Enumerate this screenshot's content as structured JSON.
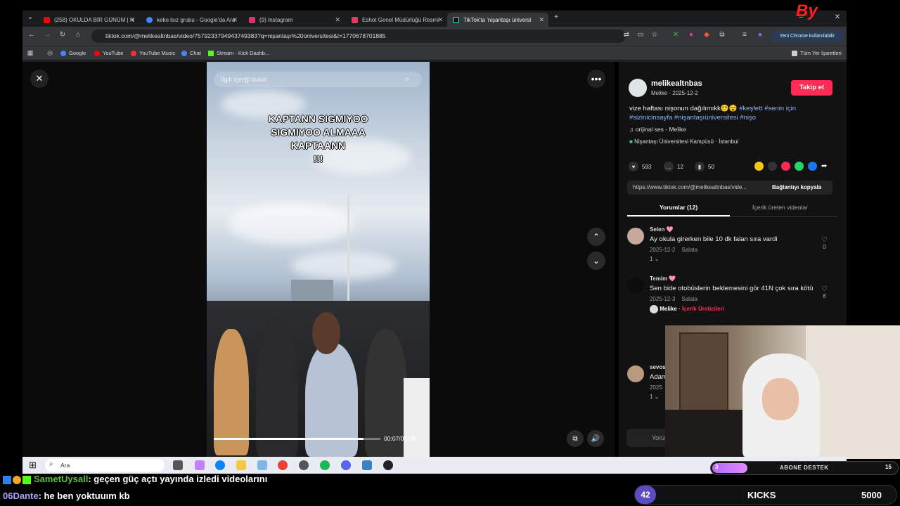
{
  "browser": {
    "tabs": [
      {
        "label": "(258) OKULDA BİR GÜNÜM | N",
        "color": "#ff0000"
      },
      {
        "label": "keko lsız grubu - Google'da Ara",
        "color": "#4285f4"
      },
      {
        "label": "(9) Instagram",
        "color": "#e1306c"
      },
      {
        "label": "Eshot Genel Müdürlüğü Resmi",
        "color": "#e33b5c"
      },
      {
        "label": "TikTok'ta 'nişantaşı üniversi",
        "color": "#111111"
      }
    ],
    "url": "tiktok.com/@melikealtnbas/video/7579233794943749383?q=nişantaşı%20üniversitesi&t=1770678701885",
    "profile_button": "Yeni Chrome kullanılabilir",
    "bookmarks": [
      "Google",
      "YouTube",
      "YouTube Music",
      "Chat",
      "Stream - Kick Dashb..."
    ],
    "all_bookmarks": "Tüm Yer İşaretleri"
  },
  "video": {
    "search_placeholder": "İlgili içeriği bulun",
    "caption_lines": [
      "KAPTANN SIGMIYOO",
      "SIGMIYOO ALMAAA",
      "KAPTAANN",
      "!!!"
    ],
    "time": "00:07/00:08",
    "progress": 0.9
  },
  "post": {
    "username": "melikealtnbas",
    "subline": "Melike · 2025-12-2",
    "follow": "Takip et",
    "description": "vize haftası nişonun dağılımıkk😵‍💫😵 ",
    "hashtags": "#keşfett #senin için #sizinicinsayfa #nişantaşıüniversitesi #nişo",
    "sound": "orijinal ses - Melike",
    "location": "Nişantaşı Üniversitesi Kampüsü · İstanbul",
    "likes": "593",
    "comments": "12",
    "saves": "50",
    "link": "https://www.tiktok.com/@melikealtnbas/vide...",
    "copy_link": "Bağlantıyı kopyala",
    "tab_comments": "Yorumlar (12)",
    "tab_creator": "İçerik üreten videolar",
    "comment_input": "Yorum"
  },
  "comments": [
    {
      "name": "Selen 🩷",
      "text": "Ay okula girerken bile 10 dk falan sıra vardi",
      "date": "2025-12-2",
      "reply": "Salata",
      "likes": "0",
      "replies": "1"
    },
    {
      "name": "Temim 🩷",
      "text": "Sen bide otobüslerin beklemesini gör 41N çok sıra kötü",
      "date": "2025-12-3",
      "reply": "Salata",
      "likes": "8",
      "creator": "Melike",
      "creator_tag": "İçerik Üreticileri"
    },
    {
      "name": "sevos",
      "text": "Adam",
      "date": "2025",
      "replies": "1"
    }
  ],
  "taskbar": {
    "search": "Ara"
  },
  "overlay": {
    "chat": [
      {
        "user": "SametUysall",
        "message": ": geçen güç açtı yayında izledi videolarını",
        "color": "#5bc236"
      },
      {
        "user": "06Dante",
        "message": ": he ben yoktuuım kb",
        "color": "#a9a3ff"
      }
    ],
    "kicks_count": "42",
    "kicks_label": "KICKS",
    "kicks_goal": "5000",
    "sub_label": "ABONE DESTEK",
    "sub_left": "3",
    "sub_right": "15"
  }
}
